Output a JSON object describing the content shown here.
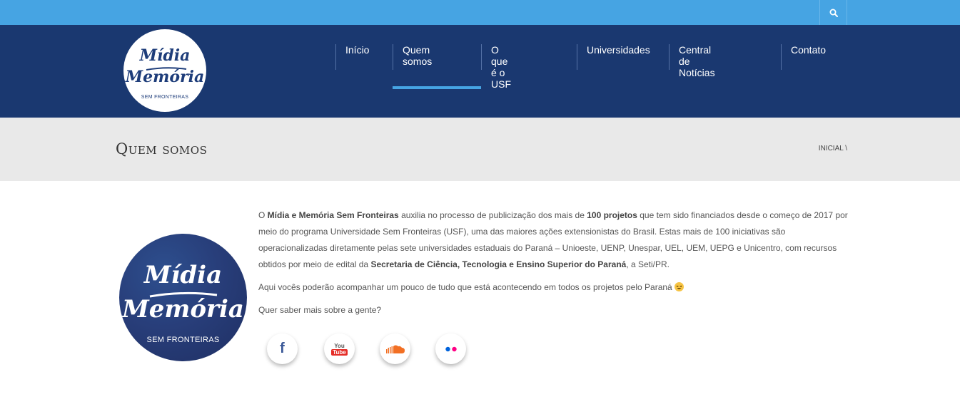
{
  "topbar": {
    "search_icon": "search-icon"
  },
  "logo": {
    "line1": "Mídia",
    "line2": "Memória",
    "tagline": "SEM FRONTEIRAS"
  },
  "nav": {
    "items": [
      {
        "label": "Início"
      },
      {
        "label": "Quem somos",
        "active": true
      },
      {
        "label": "O que é o USF"
      },
      {
        "label": "Universidades"
      },
      {
        "label": "Central de Notícias"
      },
      {
        "label": "Contato"
      }
    ]
  },
  "page": {
    "title": "Quem somos",
    "breadcrumb": "INICIAL \\"
  },
  "content": {
    "p1": {
      "t1": "O ",
      "b1": "Mídia e Memória Sem Fronteiras",
      "t2": " auxilia no processo de publicização dos mais de ",
      "b2": "100 projetos",
      "t3": " que tem sido financiados desde o começo de 2017 por meio do programa Universidade Sem Fronteiras (USF), uma das maiores ações extensionistas do Brasil. Estas mais de 100 iniciativas são operacionalizadas diretamente pelas sete universidades estaduais do Paraná – Unioeste, UENP, Unespar, UEL, UEM, UEPG e Unicentro, com recursos obtidos por meio de edital da ",
      "b3": "Secretaria de Ciência, Tecnologia e Ensino Superior do Paraná",
      "t4": ", a Seti/PR."
    },
    "p2": "Aqui vocês poderão acompanhar um pouco de tudo que está acontecendo em todos os projetos pelo Paraná",
    "p3": "Quer saber mais sobre a gente?"
  },
  "social": [
    {
      "name": "facebook",
      "glyph": "f"
    },
    {
      "name": "youtube",
      "you": "You",
      "tube": "Tube"
    },
    {
      "name": "soundcloud"
    },
    {
      "name": "flickr"
    }
  ],
  "colors": {
    "topbar": "#46a4e3",
    "header": "#1a3870",
    "accent": "#46a4e3",
    "facebook": "#3b5998",
    "youtube": "#e52d27",
    "soundcloud": "#f26f23",
    "flickr_blue": "#0063dc",
    "flickr_pink": "#ff0084"
  }
}
